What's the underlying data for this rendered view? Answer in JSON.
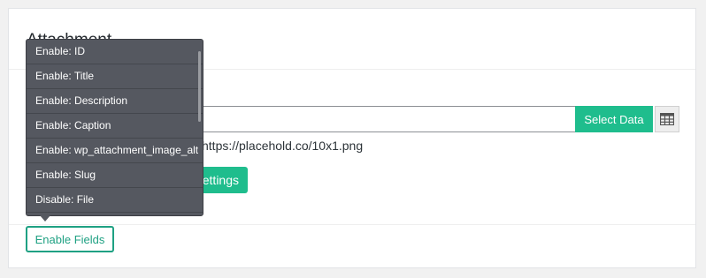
{
  "panel": {
    "title": "Attachment"
  },
  "url_field": {
    "value": "",
    "placeholder": ""
  },
  "select_data_label": "Select Data",
  "table_icon": "table-icon",
  "url_text": "https://placehold.co/10x1.png",
  "settings_label": "ettings",
  "enable_fields_label": "Enable Fields",
  "dropdown": {
    "items": [
      "Enable: ID",
      "Enable: Title",
      "Enable: Description",
      "Enable: Caption",
      "Enable: wp_attachment_image_alt",
      "Enable: Slug",
      "Disable: File"
    ]
  },
  "colors": {
    "accent": "#1fbd8d",
    "dropdown_bg": "#555860"
  }
}
